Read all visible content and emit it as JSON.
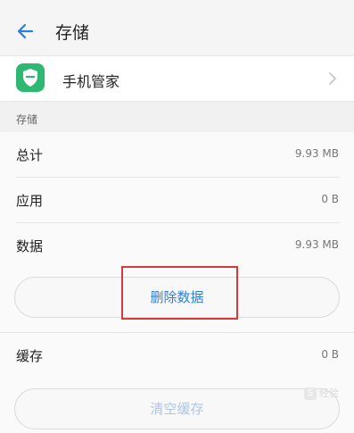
{
  "header": {
    "title": "存储",
    "back_icon": "back-arrow-icon"
  },
  "app": {
    "name": "手机管家",
    "icon": "phone-manager-shield-icon",
    "icon_color": "#2eb872"
  },
  "storage": {
    "section_title": "存储",
    "total": {
      "label": "总计",
      "value": "9.93 MB"
    },
    "apps": {
      "label": "应用",
      "value": "0 B"
    },
    "data": {
      "label": "数据",
      "value": "9.93 MB"
    },
    "clear_data_button": "删除数据"
  },
  "cache": {
    "label": "缓存",
    "value": "0 B",
    "clear_cache_button": "清空缓存"
  },
  "colors": {
    "accent": "#2f7fd6",
    "highlight": "#d63b3b"
  },
  "watermark": {
    "text": "经验"
  }
}
